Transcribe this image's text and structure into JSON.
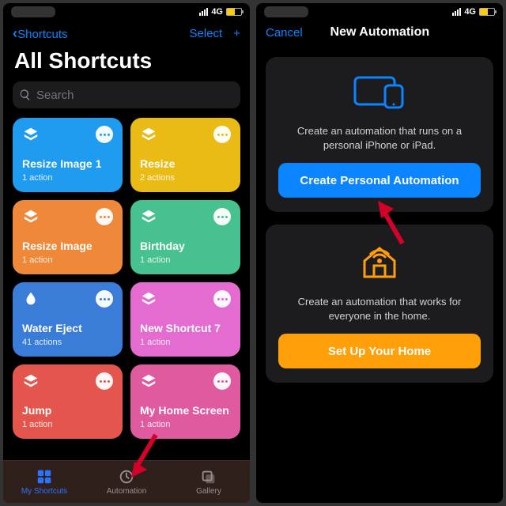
{
  "status": {
    "network": "4G"
  },
  "left": {
    "nav_back": "Shortcuts",
    "nav_select": "Select",
    "title": "All Shortcuts",
    "search_placeholder": "Search",
    "tiles": [
      {
        "name": "Resize Image 1",
        "sub": "1 action",
        "color": "#1f9cf0",
        "dot": "#1f9cf0",
        "icon": "layers"
      },
      {
        "name": "Resize",
        "sub": "2 actions",
        "color": "#e9bb14",
        "dot": "#e9bb14",
        "icon": "layers"
      },
      {
        "name": "Resize Image",
        "sub": "1 action",
        "color": "#f0883a",
        "dot": "#f0883a",
        "icon": "layers"
      },
      {
        "name": "Birthday",
        "sub": "1 action",
        "color": "#47c190",
        "dot": "#47c190",
        "icon": "layers"
      },
      {
        "name": "Water Eject",
        "sub": "41 actions",
        "color": "#3a7dd8",
        "dot": "#3a7dd8",
        "icon": "drop"
      },
      {
        "name": "New Shortcut 7",
        "sub": "1 action",
        "color": "#e46bd0",
        "dot": "#e46bd0",
        "icon": "layers"
      },
      {
        "name": "Jump",
        "sub": "1 action",
        "color": "#e4554d",
        "dot": "#e4554d",
        "icon": "layers"
      },
      {
        "name": "My Home Screen",
        "sub": "1 action",
        "color": "#e05aa0",
        "dot": "#e05aa0",
        "icon": "layers"
      }
    ],
    "tabs": {
      "shortcuts": "My Shortcuts",
      "automation": "Automation",
      "gallery": "Gallery"
    }
  },
  "right": {
    "cancel": "Cancel",
    "title": "New Automation",
    "personal": {
      "desc": "Create an automation that runs on a personal iPhone or iPad.",
      "button": "Create Personal Automation",
      "button_color": "#0a84ff"
    },
    "home": {
      "desc": "Create an automation that works for everyone in the home.",
      "button": "Set Up Your Home",
      "button_color": "#ff9f0a"
    }
  }
}
